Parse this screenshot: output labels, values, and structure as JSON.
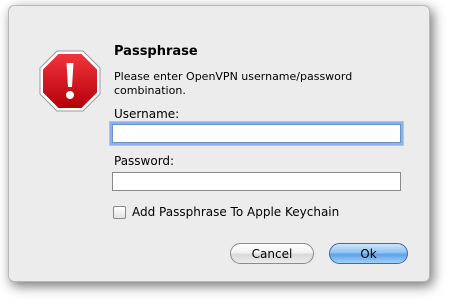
{
  "dialog": {
    "title": "Passphrase",
    "message": "Please enter OpenVPN username/password combination.",
    "username_label": "Username:",
    "username_value": "",
    "password_label": "Password:",
    "password_value": "",
    "checkbox_label": "Add Passphrase To Apple Keychain",
    "checkbox_checked": false,
    "cancel_label": "Cancel",
    "ok_label": "Ok",
    "icon": "stop-alert-icon"
  },
  "colors": {
    "window_bg": "#ececec",
    "alert_red": "#d8111c",
    "focus_ring": "#8db3e6",
    "default_button": "#5fa2e6"
  }
}
